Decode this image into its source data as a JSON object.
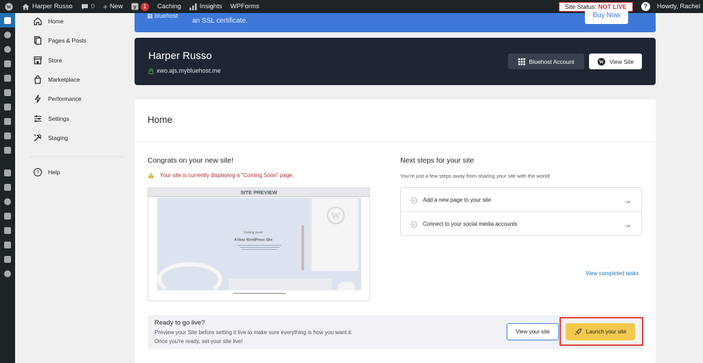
{
  "admin_bar": {
    "site_name": "Harper Russo",
    "comments_count": "0",
    "new_label": "New",
    "yoast_badge": "1",
    "caching": "Caching",
    "insights": "Insights",
    "wpforms": "WPForms",
    "site_status_label": "Site Status:",
    "site_status_value": "NOT LIVE",
    "howdy": "Howdy, Rachel"
  },
  "nav": {
    "items": [
      {
        "label": "Home",
        "icon": "home-icon"
      },
      {
        "label": "Pages & Posts",
        "icon": "pages-icon"
      },
      {
        "label": "Store",
        "icon": "store-icon"
      },
      {
        "label": "Marketplace",
        "icon": "marketplace-icon"
      },
      {
        "label": "Performance",
        "icon": "bolt-icon"
      },
      {
        "label": "Settings",
        "icon": "sliders-icon"
      },
      {
        "label": "Staging",
        "icon": "tools-icon"
      }
    ],
    "help": "Help"
  },
  "banner": {
    "logo": "bluehost",
    "text": "an SSL certificate.",
    "buy_now": "Buy Now"
  },
  "site_header": {
    "name": "Harper Russo",
    "url": "xwo.ajs.mybluehost.me",
    "account_button": "Bluehost Account",
    "view_site_button": "View Site"
  },
  "home": {
    "title": "Home",
    "congrats_title": "Congrats on your new site!",
    "coming_soon_warning": "Your site is currently displaying a \"Coming Soon\" page.",
    "preview_label": "SITE PREVIEW",
    "preview_small": "Coming Soon!",
    "preview_heading": "A New WordPress Site",
    "next_steps_title": "Next steps for your site",
    "next_steps_sub": "You're just a few steps away from sharing your site with the world!",
    "tasks": [
      {
        "label": "Add a new page to your site"
      },
      {
        "label": "Connect to your social media accounts"
      }
    ],
    "view_completed": "View completed tasks",
    "go_live_title": "Ready to go live?",
    "go_live_line1": "Preview your Site before setting it live to make sure everything is how you want it.",
    "go_live_line2": "Once you're ready, set your site live!",
    "view_your_site": "View your site",
    "launch_your_site": "Launch your site"
  },
  "colors": {
    "admin_bar": "#1d2327",
    "banner_blue": "#3c78d8",
    "site_header_bg": "#1f2533",
    "launch_button": "#f2c94c",
    "highlight_red": "#e33b30"
  }
}
